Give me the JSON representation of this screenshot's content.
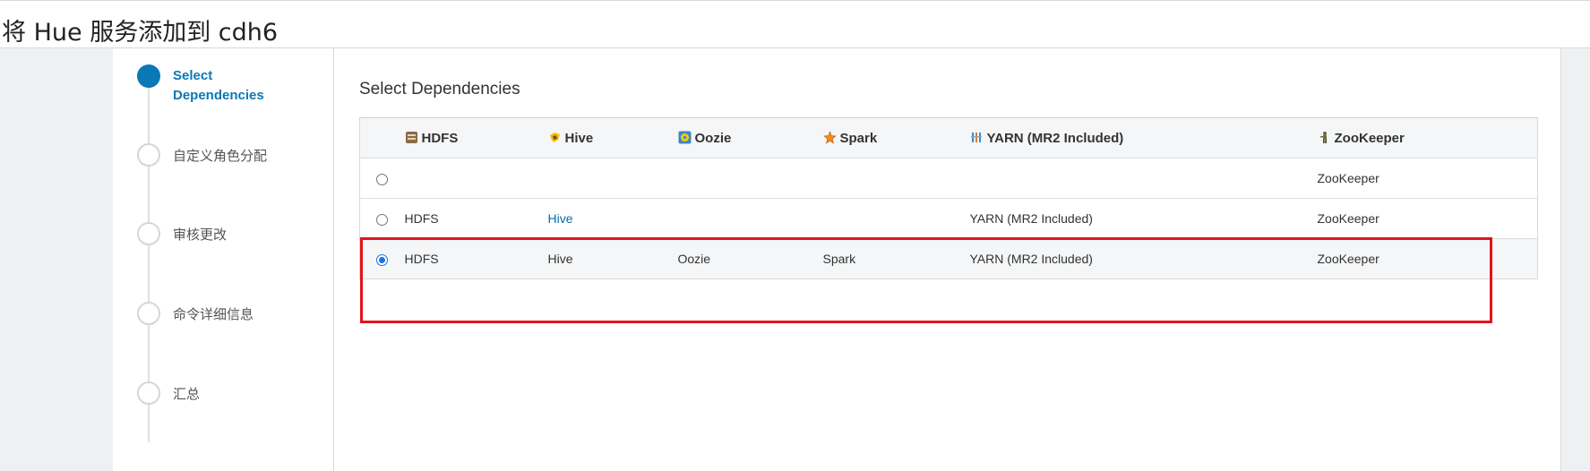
{
  "page": {
    "title": "将 Hue 服务添加到 cdh6"
  },
  "wizard": {
    "steps": [
      {
        "label": "Select Dependencies",
        "active": true
      },
      {
        "label": "自定义角色分配",
        "active": false
      },
      {
        "label": "审核更改",
        "active": false
      },
      {
        "label": "命令详细信息",
        "active": false
      },
      {
        "label": "汇总",
        "active": false
      }
    ]
  },
  "main": {
    "section_title": "Select Dependencies",
    "table": {
      "headers": [
        {
          "label": "HDFS",
          "icon": "hdfs-icon"
        },
        {
          "label": "Hive",
          "icon": "hive-icon"
        },
        {
          "label": "Oozie",
          "icon": "oozie-icon"
        },
        {
          "label": "Spark",
          "icon": "spark-icon"
        },
        {
          "label": "YARN (MR2 Included)",
          "icon": "yarn-icon"
        },
        {
          "label": "ZooKeeper",
          "icon": "zookeeper-icon"
        }
      ],
      "rows": [
        {
          "selected": false,
          "hdfs": "",
          "hive": "",
          "oozie": "",
          "spark": "",
          "yarn": "",
          "zookeeper": "ZooKeeper"
        },
        {
          "selected": false,
          "hdfs": "HDFS",
          "hive": "Hive",
          "oozie": "",
          "spark": "",
          "yarn": "YARN (MR2 Included)",
          "zookeeper": "ZooKeeper"
        },
        {
          "selected": true,
          "hdfs": "HDFS",
          "hive": "Hive",
          "oozie": "Oozie",
          "spark": "Spark",
          "yarn": "YARN (MR2 Included)",
          "zookeeper": "ZooKeeper"
        }
      ]
    }
  },
  "colors": {
    "accent": "#0a78b5",
    "highlight_border": "#e0141e",
    "link": "#0a6aa6"
  }
}
